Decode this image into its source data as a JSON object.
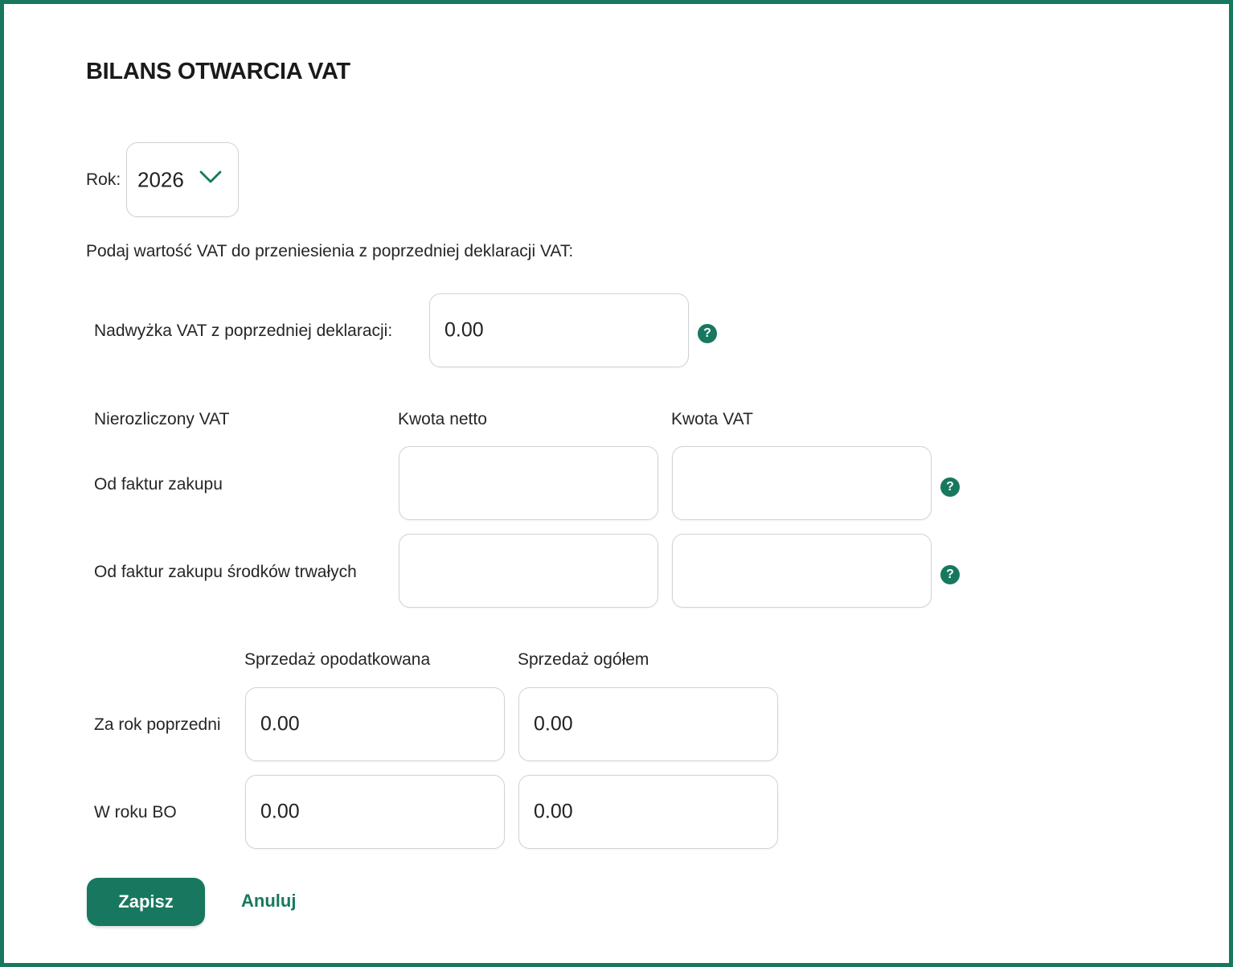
{
  "title": "BILANS OTWARCIA VAT",
  "year": {
    "label": "Rok:",
    "value": "2026"
  },
  "instruction": "Podaj wartość VAT do przeniesienia z poprzedniej deklaracji VAT:",
  "surplus": {
    "label": "Nadwyżka VAT z poprzedniej deklaracji:",
    "value": "0.00",
    "help_icon": "question-circle-icon"
  },
  "unsettled": {
    "section_label": "Nierozliczony VAT",
    "col_net": "Kwota netto",
    "col_vat": "Kwota VAT",
    "rows": [
      {
        "label": "Od faktur zakupu",
        "net": "",
        "vat": ""
      },
      {
        "label": "Od faktur zakupu środków trwałych",
        "net": "",
        "vat": ""
      }
    ]
  },
  "sales": {
    "col_taxed": "Sprzedaż opodatkowana",
    "col_total": "Sprzedaż ogółem",
    "rows": [
      {
        "label": "Za rok poprzedni",
        "taxed": "0.00",
        "total": "0.00"
      },
      {
        "label": "W roku BO",
        "taxed": "0.00",
        "total": "0.00"
      }
    ]
  },
  "actions": {
    "save": "Zapisz",
    "cancel": "Anuluj"
  },
  "colors": {
    "accent": "#17785f",
    "border": "#cfd3d6"
  }
}
